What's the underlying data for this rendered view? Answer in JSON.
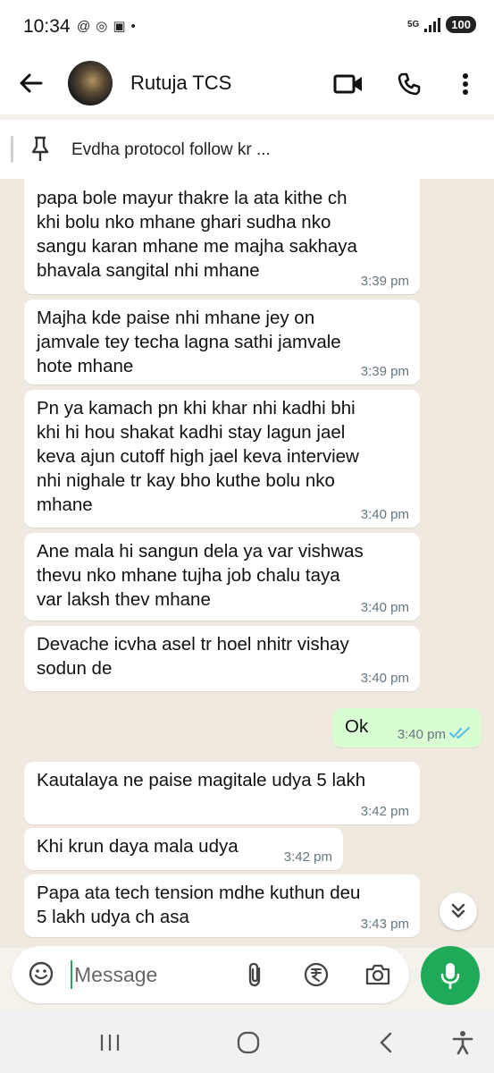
{
  "status": {
    "time": "10:34",
    "network": "5G",
    "battery": "100"
  },
  "header": {
    "contact_name": "Rutuja TCS"
  },
  "pinned": {
    "text": "Evdha protocol follow kr ..."
  },
  "messages": [
    {
      "text": "papa bole mayur thakre la ata kithe ch\nkhi bolu nko mhane ghari sudha nko\nsangu karan mhane me majha sakhaya\nbhavala sangital nhi mhane",
      "time": "3:39 pm"
    },
    {
      "text": "Majha kde paise nhi mhane jey on\njamvale tey techa lagna sathi jamvale\nhote mhane",
      "time": "3:39 pm"
    },
    {
      "text": "Pn ya kamach pn khi khar nhi kadhi bhi\nkhi hi hou shakat kadhi stay lagun jael\nkeva ajun cutoff high jael keva interview\nnhi nighale tr kay bho kuthe bolu nko\nmhane",
      "time": "3:40 pm"
    },
    {
      "text": "Ane mala hi sangun dela ya var vishwas\nthevu nko mhane tujha job chalu taya\nvar laksh thev mhane",
      "time": "3:40 pm"
    },
    {
      "text": "Devache icvha asel tr hoel nhitr vishay\nsodun de",
      "time": "3:40 pm"
    },
    {
      "text": "Ok",
      "time": "3:40 pm",
      "outgoing": true,
      "status": "read"
    },
    {
      "text": "Kautalaya ne paise magitale udya  5 lakh",
      "time": "3:42 pm"
    },
    {
      "text": "Khi krun daya mala udya",
      "time": "3:42 pm"
    },
    {
      "text": "Papa ata tech tension mdhe kuthun deu\n5 lakh udya ch asa",
      "time": "3:43 pm"
    }
  ],
  "composer": {
    "placeholder": "Message"
  },
  "colors": {
    "outgoing_bubble": "#d9fdd3",
    "read_ticks": "#53bdeb",
    "mic_button": "#1faa59"
  }
}
